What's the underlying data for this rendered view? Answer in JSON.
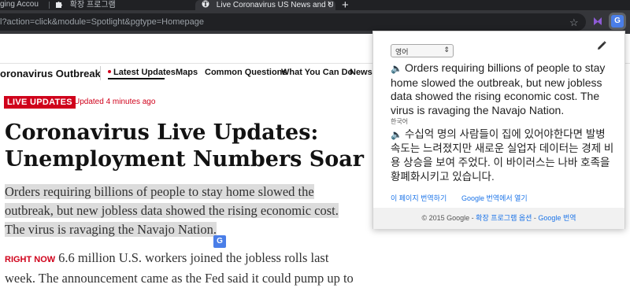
{
  "browser": {
    "tabs": [
      {
        "label": "ging Accou"
      },
      {
        "label": "확장 프로그램"
      },
      {
        "label": "Live Coronavirus US News and U"
      }
    ],
    "new_tab_symbol": "+",
    "close_symbol": "×",
    "url": "l?action=click&module=Spotlight&pgtype=Homepage",
    "star_symbol": "☆",
    "extension_label": "G"
  },
  "site": {
    "brand": "oronavirus Outbreak",
    "nav": [
      {
        "label": "Latest Updates"
      },
      {
        "label": "Maps"
      },
      {
        "label": "Common Questions"
      },
      {
        "label": "What You Can Do"
      },
      {
        "label": "Newsle"
      }
    ]
  },
  "article": {
    "badge": "LIVE UPDATES",
    "updated": "Updated 4 minutes ago",
    "headline": "Coronavirus Live Updates: Unemployment Numbers Soar",
    "summary_lines": [
      "Orders requiring billions of people to stay home slowed the",
      "outbreak, but new jobless data showed the rising economic cost.",
      "The virus is ravaging the Navajo Nation."
    ],
    "right_now_label": "RIGHT NOW",
    "body_lines": [
      "6.6 million U.S. workers joined the jobless rolls last",
      "week. The announcement came as the Fed said it could pump up to"
    ],
    "translate_icon_label": "G"
  },
  "translate_popup": {
    "source_language": "영어",
    "source_text": "Orders requiring billions of people to stay home slowed the outbreak, but new jobless data showed the rising economic cost. The virus is ravaging the Navajo Nation.",
    "target_language": "한국어",
    "target_text": "수십억 명의 사람들이 집에 있어야한다면 발병 속도는 느려졌지만 새로운 실업자 데이터는 경제 비용 상승을 보여 주었다. 이 바이러스는 나바 호족을 황폐화시키고 있습니다.",
    "speaker_symbol": "🔈",
    "link_translate_page": "이 페이지 번역하기",
    "link_open_in_google": "Google 번역에서 열기",
    "footer_prefix": "© 2015 Google - ",
    "footer_options": "확장 프로그램 옵션",
    "footer_sep": " - ",
    "footer_google_translate": "Google 번역"
  },
  "colors": {
    "accent_red": "#d0021b",
    "link_blue": "#1a73e8",
    "chrome_dark": "#202124"
  }
}
